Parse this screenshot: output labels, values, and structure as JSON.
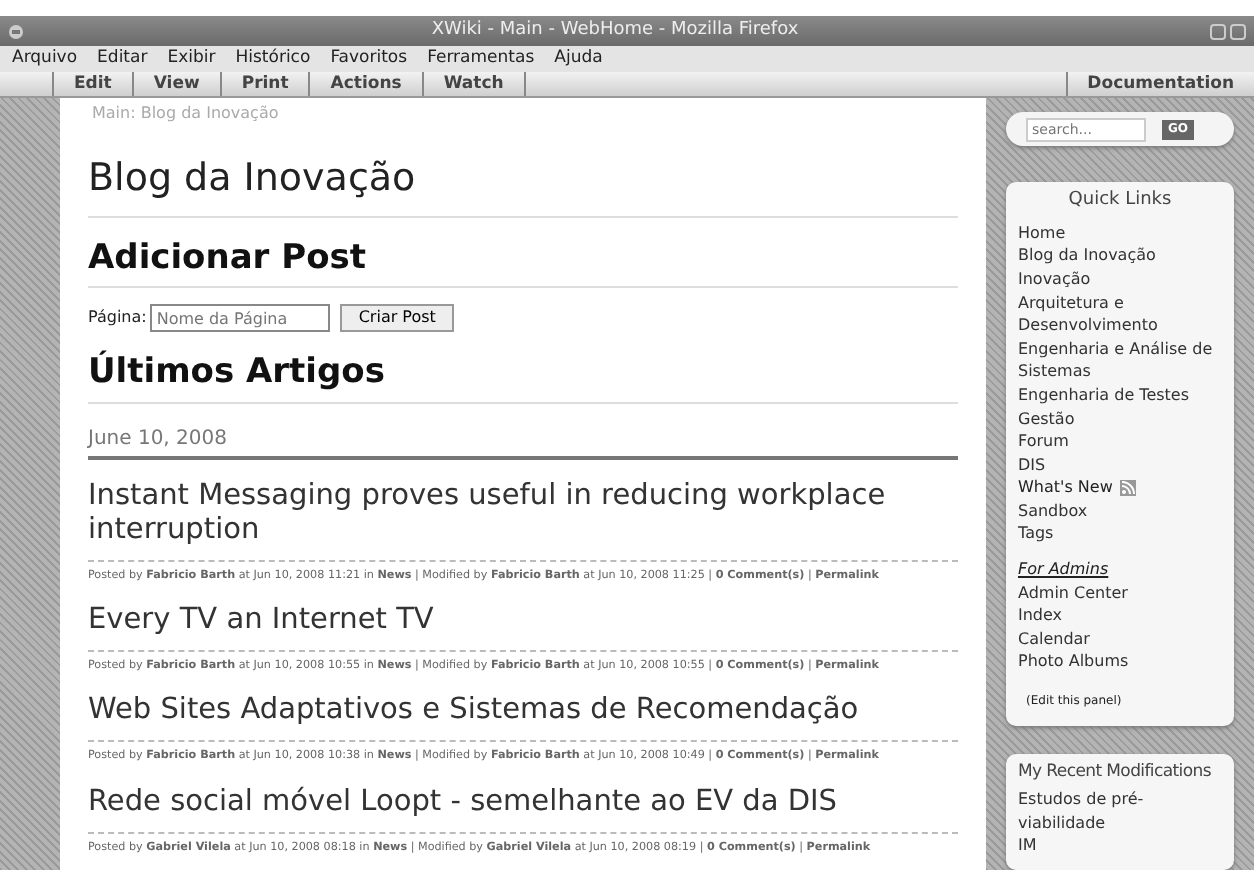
{
  "window": {
    "title": "XWiki - Main - WebHome - Mozilla Firefox"
  },
  "menu": [
    "Arquivo",
    "Editar",
    "Exibir",
    "Histórico",
    "Favoritos",
    "Ferramentas",
    "Ajuda"
  ],
  "toolbar": {
    "left": [
      "Edit",
      "View",
      "Print",
      "Actions",
      "Watch"
    ],
    "right": "Documentation"
  },
  "breadcrumb": "Main: Blog da Inovação",
  "page_title": "Blog da Inovação",
  "add_post": {
    "heading": "Adicionar Post",
    "label": "Página:",
    "placeholder": "Nome da Página",
    "button": "Criar Post"
  },
  "latest": {
    "heading": "Últimos Artigos",
    "date": "June 10, 2008",
    "posts": [
      {
        "title": "Instant Messaging proves useful in reducing workplace interruption",
        "meta": "Posted by **Fabricio Barth** at Jun 10, 2008 11:21 in **News** | Modified by **Fabricio Barth** at Jun 10, 2008 11:25 | **0 Comment(s)** | **Permalink**"
      },
      {
        "title": "Every TV an Internet TV",
        "meta": "Posted by **Fabricio Barth** at Jun 10, 2008 10:55 in **News** | Modified by **Fabricio Barth** at Jun 10, 2008 10:55 | **0 Comment(s)** | **Permalink**"
      },
      {
        "title": "Web Sites Adaptativos e Sistemas de Recomendação",
        "meta": "Posted by **Fabricio Barth** at Jun 10, 2008 10:38 in **News** | Modified by **Fabricio Barth** at Jun 10, 2008 10:49 | **0 Comment(s)** | **Permalink**"
      },
      {
        "title": "Rede social móvel Loopt - semelhante ao EV da DIS",
        "meta": "Posted by **Gabriel Vilela** at Jun 10, 2008 08:18 in **News** | Modified by **Gabriel Vilela** at Jun 10, 2008 08:19 | **0 Comment(s)** | **Permalink**"
      }
    ]
  },
  "search": {
    "placeholder": "search...",
    "button": "GO"
  },
  "quick_links": {
    "title": "Quick Links",
    "items": [
      {
        "label": "Home",
        "kind": "link"
      },
      {
        "label": "Blog da Inovação",
        "kind": "link"
      },
      {
        "label": "Inovação",
        "kind": "link"
      },
      {
        "label": "Arquitetura e Desenvolvimento",
        "kind": "link"
      },
      {
        "label": "Engenharia e Análise de Sistemas",
        "kind": "link"
      },
      {
        "label": "Engenharia de Testes",
        "kind": "link"
      },
      {
        "label": "Gestão",
        "kind": "link"
      },
      {
        "label": "Forum",
        "kind": "link"
      },
      {
        "label": "DIS",
        "kind": "link"
      },
      {
        "label": "What's New",
        "kind": "feed"
      },
      {
        "label": "Sandbox",
        "kind": "link"
      },
      {
        "label": "Tags",
        "kind": "link"
      }
    ],
    "admin_heading": "For Admins",
    "admin_items": [
      "Admin Center",
      "Index",
      "Calendar",
      "Photo Albums"
    ],
    "edit_link": "(Edit this panel)"
  },
  "recent": {
    "title": "My Recent Modifications",
    "items": [
      "Estudos de pré-viabilidade",
      "IM"
    ]
  }
}
